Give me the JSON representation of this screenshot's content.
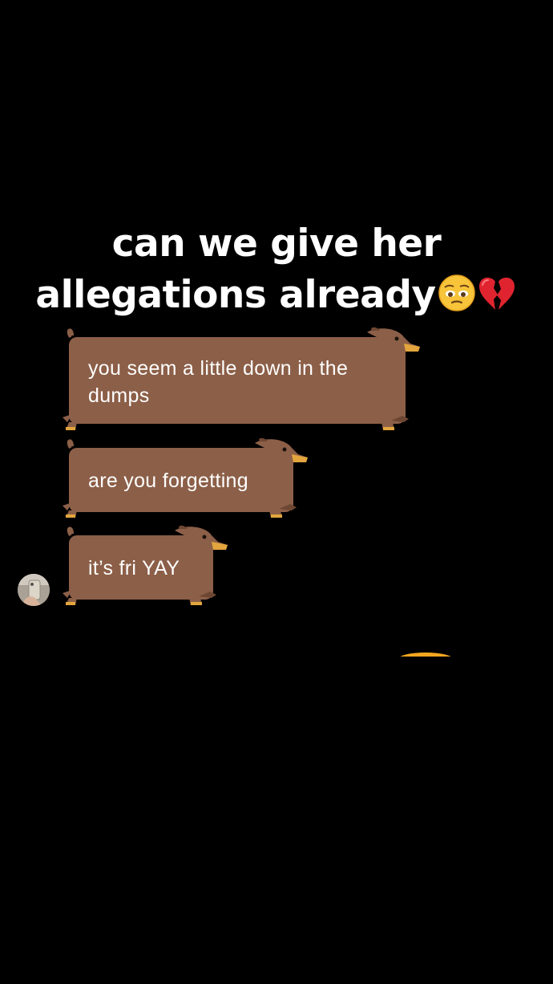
{
  "caption": {
    "line1": "can we give her",
    "line2": "allegations already",
    "emoji_1": "pensive-face-emoji",
    "emoji_2": "broken-heart-emoji"
  },
  "messages": [
    {
      "text_line1": "you seem a little down in the",
      "text_line2": "dumps"
    },
    {
      "text_line1": "are you forgetting"
    },
    {
      "text_line1": "it’s fri YAY"
    }
  ],
  "theme": {
    "background": "#000000",
    "bubble_color": "#8c5f48",
    "dog_paw_color": "#e3a53d",
    "text_color": "#ffffff",
    "typing_indicator_color": "#f4a71f"
  },
  "icons": {
    "bubble_style": "dachshund-bubble",
    "avatar": "profile-avatar"
  }
}
